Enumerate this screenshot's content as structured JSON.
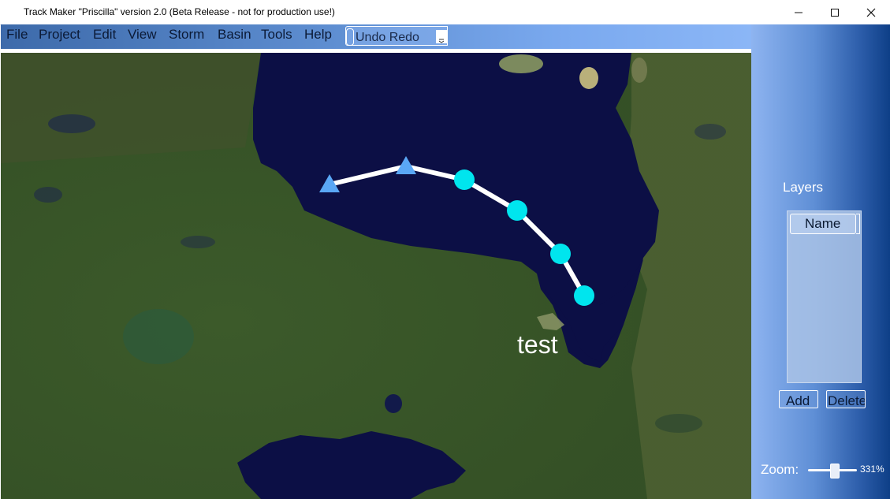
{
  "window": {
    "title": "Track Maker \"Priscilla\" version 2.0 (Beta Release - not for production use!)",
    "controls": [
      "minimize-icon",
      "maximize-icon",
      "close-icon"
    ]
  },
  "menu": {
    "items": [
      "File",
      "Project",
      "Edit",
      "View",
      "Storm",
      "Basin",
      "Tools",
      "Help"
    ],
    "undo_redo": "Undo Redo"
  },
  "map": {
    "storm_label": "test",
    "track": {
      "line_color": "#ffffff",
      "points": [
        {
          "shape": "triangle",
          "color": "#5aa7f5"
        },
        {
          "shape": "triangle",
          "color": "#5aa7f5"
        },
        {
          "shape": "circle",
          "color": "#00e5ee"
        },
        {
          "shape": "circle",
          "color": "#00e5ee"
        },
        {
          "shape": "circle",
          "color": "#00e5ee"
        },
        {
          "shape": "circle",
          "color": "#00e5ee"
        }
      ]
    }
  },
  "layers": {
    "title": "Layers",
    "column_header": "Name",
    "add_label": "Add",
    "delete_label": "Delete"
  },
  "zoom": {
    "label": "Zoom:",
    "value": "331%",
    "slider_fraction": 0.55
  },
  "colors": {
    "water": "#0c0f45",
    "land": "#3e5a2a",
    "menubar_accent": "#5f8fd2",
    "panel_dark": "#0e3f87"
  }
}
